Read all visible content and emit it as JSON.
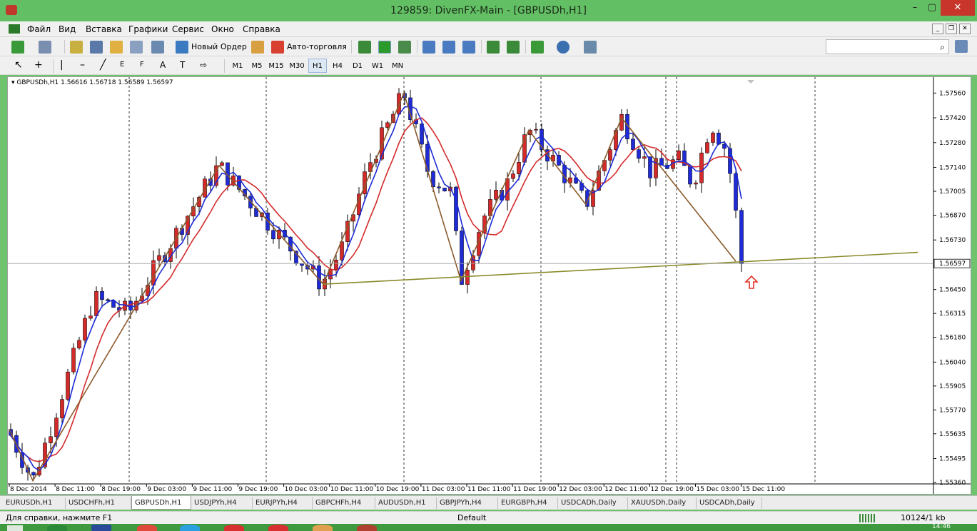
{
  "window": {
    "title": "129859: DivenFX-Main - [GBPUSDh,H1]",
    "min": "–",
    "max": "▢",
    "close": "✕"
  },
  "menu": {
    "items": [
      "Файл",
      "Вид",
      "Вставка",
      "Графики",
      "Сервис",
      "Окно",
      "Справка"
    ]
  },
  "toolbar": {
    "new_order": "Новый Ордер",
    "auto_trading": "Авто-торговля"
  },
  "tool_labels": [
    "E",
    "F",
    "A",
    "T"
  ],
  "timeframes": [
    "M1",
    "M5",
    "M15",
    "M30",
    "H1",
    "H4",
    "D1",
    "W1",
    "MN"
  ],
  "active_timeframe": "H1",
  "symbol_info": "GBPUSDh,H1  1.56616 1.56718 1.56589 1.56597",
  "chart_data": {
    "type": "candlestick",
    "symbol": "GBPUSDh",
    "timeframe": "H1",
    "ohlc_last": [
      1.56616,
      1.56718,
      1.56589,
      1.56597
    ],
    "ylim": [
      1.5536,
      1.5763
    ],
    "y_ticks": [
      "1.57560",
      "1.57420",
      "1.57280",
      "1.57140",
      "1.57005",
      "1.56870",
      "1.56730",
      "1.56597",
      "1.56450",
      "1.56315",
      "1.56180",
      "1.56040",
      "1.55905",
      "1.55770",
      "1.55635",
      "1.55495",
      "1.55360"
    ],
    "current_price": "1.56597",
    "x_ticks": [
      "8 Dec 2014",
      "8 Dec 11:00",
      "8 Dec 19:00",
      "9 Dec 03:00",
      "9 Dec 11:00",
      "9 Dec 19:00",
      "10 Dec 03:00",
      "10 Dec 11:00",
      "10 Dec 19:00",
      "11 Dec 03:00",
      "11 Dec 11:00",
      "11 Dec 19:00",
      "12 Dec 03:00",
      "12 Dec 11:00",
      "12 Dec 19:00",
      "15 Dec 03:00",
      "15 Dec 11:00"
    ],
    "bull_color": "#d42a2a",
    "bear_color": "#1f2bd6",
    "zigzag_color": "#8b5a2b",
    "trendline_color": "#8a8a2a",
    "ma_fast_color": "#1c2bd6",
    "ma_slow_color": "#d42a2a",
    "arrow_color": "#e03020"
  },
  "tabs": [
    "EURUSDh,H1",
    "USDCHFh,H1",
    "GBPUSDh,H1",
    "USDJPYh,H4",
    "EURJPYh,H4",
    "GBPCHFh,H4",
    "AUDUSDh,H1",
    "GBPJPYh,H4",
    "EURGBPh,H4",
    "USDCADh,Daily",
    "XAUUSDh,Daily",
    "USDCADh,Daily"
  ],
  "active_tab": "GBPUSDh,H1",
  "status": {
    "help": "Для справки, нажмите F1",
    "profile": "Default",
    "traffic": "10124/1 kb"
  },
  "taskbar": {
    "clock": "14:46"
  }
}
